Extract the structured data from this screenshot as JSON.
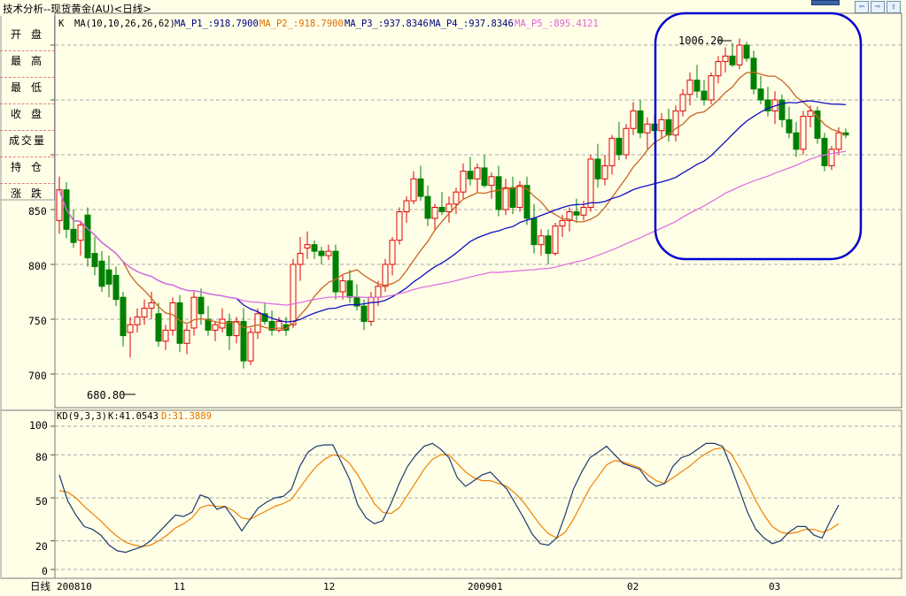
{
  "window": {
    "title": "技术分析--现货黄金(AU)<日线>",
    "controls": [
      "⇦",
      "⇨",
      "⇧"
    ]
  },
  "side_panel": {
    "items": [
      "开盘",
      "最高",
      "最低",
      "收盘",
      "成交量",
      "持仓",
      "涨跌"
    ]
  },
  "price_panel": {
    "k_label": "K",
    "ma_name": "MA(10,10,26,26,62)",
    "ma_values": [
      {
        "label": "MA_P1_:918.7900",
        "color": "#000080"
      },
      {
        "label": "MA_P2_:918.7900",
        "color": "#e07000"
      },
      {
        "label": "MA_P3_:937.8346",
        "color": "#000080"
      },
      {
        "label": "MA_P4_:937.8346",
        "color": "#000080"
      },
      {
        "label": "MA_P5_:895.4121",
        "color": "#e060e0"
      }
    ],
    "high_marker": "1006.20",
    "low_marker": "680.80",
    "y_ticks": [
      "850",
      "800",
      "750",
      "700"
    ]
  },
  "kd_panel": {
    "name": "KD(9,3,3)",
    "k_value": "K:41.0543",
    "d_value": "D:31.3889",
    "y_ticks": [
      "100",
      "80",
      "50",
      "20",
      "0"
    ]
  },
  "x_axis": {
    "period": "日线",
    "labels": [
      "200810",
      "11",
      "12",
      "200901",
      "02",
      "03"
    ]
  },
  "colors": {
    "up": "#e00000",
    "down": "#008000",
    "ma_short": "#c86420",
    "ma_mid": "#1010c0",
    "ma_long": "#e070e0",
    "k_line": "#1e3a70",
    "d_line": "#f08000",
    "highlight": "#0000d0"
  },
  "chart_data": {
    "type": "candlestick",
    "instrument": "现货黄金(AU)",
    "interval": "日线",
    "price_ylim": [
      670,
      1020
    ],
    "kd_ylim": [
      0,
      100
    ],
    "ohlc": [
      [
        840,
        880,
        828,
        868
      ],
      [
        868,
        875,
        824,
        832
      ],
      [
        832,
        850,
        815,
        820
      ],
      [
        822,
        840,
        808,
        836
      ],
      [
        845,
        852,
        798,
        806
      ],
      [
        810,
        825,
        790,
        798
      ],
      [
        803,
        812,
        775,
        780
      ],
      [
        795,
        808,
        770,
        782
      ],
      [
        790,
        798,
        762,
        768
      ],
      [
        770,
        775,
        725,
        735
      ],
      [
        738,
        752,
        715,
        745
      ],
      [
        745,
        760,
        738,
        752
      ],
      [
        752,
        768,
        745,
        760
      ],
      [
        760,
        775,
        750,
        765
      ],
      [
        755,
        765,
        725,
        730
      ],
      [
        730,
        745,
        722,
        740
      ],
      [
        740,
        770,
        735,
        765
      ],
      [
        765,
        772,
        720,
        728
      ],
      [
        728,
        745,
        718,
        740
      ],
      [
        742,
        775,
        735,
        770
      ],
      [
        770,
        778,
        745,
        755
      ],
      [
        750,
        762,
        735,
        740
      ],
      [
        740,
        748,
        730,
        745
      ],
      [
        742,
        760,
        738,
        750
      ],
      [
        748,
        755,
        722,
        735
      ],
      [
        735,
        752,
        728,
        748
      ],
      [
        748,
        760,
        705,
        712
      ],
      [
        712,
        742,
        708,
        738
      ],
      [
        738,
        760,
        732,
        755
      ],
      [
        755,
        765,
        745,
        748
      ],
      [
        748,
        758,
        735,
        740
      ],
      [
        740,
        752,
        738,
        748
      ],
      [
        745,
        752,
        735,
        740
      ],
      [
        745,
        805,
        742,
        800
      ],
      [
        800,
        825,
        785,
        810
      ],
      [
        815,
        830,
        805,
        818
      ],
      [
        818,
        822,
        805,
        812
      ],
      [
        812,
        816,
        800,
        808
      ],
      [
        808,
        818,
        804,
        812
      ],
      [
        812,
        818,
        768,
        775
      ],
      [
        775,
        790,
        768,
        785
      ],
      [
        785,
        795,
        765,
        770
      ],
      [
        770,
        782,
        758,
        762
      ],
      [
        762,
        768,
        740,
        748
      ],
      [
        748,
        775,
        744,
        770
      ],
      [
        770,
        785,
        762,
        780
      ],
      [
        780,
        805,
        775,
        800
      ],
      [
        800,
        825,
        790,
        822
      ],
      [
        822,
        852,
        818,
        848
      ],
      [
        848,
        862,
        838,
        858
      ],
      [
        858,
        885,
        855,
        878
      ],
      [
        878,
        890,
        858,
        862
      ],
      [
        862,
        872,
        835,
        842
      ],
      [
        842,
        855,
        832,
        852
      ],
      [
        852,
        866,
        845,
        848
      ],
      [
        848,
        862,
        838,
        855
      ],
      [
        855,
        870,
        846,
        866
      ],
      [
        866,
        892,
        860,
        885
      ],
      [
        885,
        898,
        872,
        878
      ],
      [
        878,
        892,
        866,
        888
      ],
      [
        888,
        900,
        870,
        872
      ],
      [
        872,
        884,
        860,
        880
      ],
      [
        880,
        890,
        844,
        850
      ],
      [
        850,
        878,
        845,
        870
      ],
      [
        870,
        880,
        846,
        852
      ],
      [
        852,
        876,
        848,
        872
      ],
      [
        872,
        880,
        836,
        842
      ],
      [
        842,
        855,
        810,
        818
      ],
      [
        818,
        832,
        808,
        826
      ],
      [
        826,
        832,
        800,
        810
      ],
      [
        810,
        838,
        808,
        835
      ],
      [
        835,
        845,
        825,
        840
      ],
      [
        840,
        852,
        830,
        848
      ],
      [
        848,
        860,
        838,
        845
      ],
      [
        845,
        858,
        840,
        852
      ],
      [
        852,
        900,
        848,
        896
      ],
      [
        896,
        910,
        870,
        878
      ],
      [
        878,
        900,
        872,
        890
      ],
      [
        890,
        918,
        882,
        915
      ],
      [
        915,
        930,
        895,
        900
      ],
      [
        900,
        928,
        896,
        924
      ],
      [
        924,
        948,
        918,
        940
      ],
      [
        940,
        950,
        915,
        920
      ],
      [
        920,
        934,
        905,
        928
      ],
      [
        928,
        936,
        915,
        922
      ],
      [
        922,
        938,
        915,
        932
      ],
      [
        932,
        942,
        912,
        918
      ],
      [
        918,
        945,
        912,
        940
      ],
      [
        940,
        960,
        935,
        955
      ],
      [
        955,
        975,
        945,
        968
      ],
      [
        968,
        982,
        952,
        958
      ],
      [
        958,
        968,
        945,
        950
      ],
      [
        950,
        975,
        946,
        972
      ],
      [
        972,
        990,
        965,
        985
      ],
      [
        985,
        998,
        975,
        990
      ],
      [
        990,
        1002,
        980,
        982
      ],
      [
        982,
        1006,
        978,
        1000
      ],
      [
        1000,
        1003,
        985,
        988
      ],
      [
        988,
        995,
        955,
        960
      ],
      [
        960,
        972,
        946,
        950
      ],
      [
        950,
        962,
        935,
        940
      ],
      [
        940,
        958,
        928,
        950
      ],
      [
        950,
        955,
        925,
        932
      ],
      [
        932,
        944,
        915,
        920
      ],
      [
        920,
        930,
        898,
        905
      ],
      [
        905,
        940,
        900,
        935
      ],
      [
        935,
        945,
        925,
        940
      ],
      [
        940,
        944,
        910,
        915
      ],
      [
        915,
        920,
        885,
        890
      ],
      [
        890,
        908,
        886,
        905
      ],
      [
        905,
        925,
        900,
        920
      ],
      [
        920,
        924,
        915,
        918
      ]
    ],
    "kd": {
      "k": [
        66,
        48,
        38,
        30,
        28,
        24,
        17,
        13,
        12,
        14,
        16,
        20,
        26,
        32,
        38,
        37,
        40,
        52,
        50,
        42,
        44,
        36,
        27,
        35,
        43,
        47,
        50,
        51,
        56,
        72,
        82,
        86,
        87,
        87,
        75,
        63,
        45,
        36,
        32,
        34,
        46,
        60,
        72,
        80,
        86,
        88,
        84,
        78,
        64,
        58,
        62,
        66,
        68,
        62,
        56,
        46,
        36,
        25,
        18,
        17,
        22,
        38,
        56,
        68,
        78,
        82,
        86,
        80,
        74,
        72,
        70,
        62,
        58,
        60,
        72,
        78,
        80,
        84,
        88,
        88,
        86,
        72,
        56,
        40,
        28,
        22,
        18,
        20,
        26,
        30,
        30,
        24,
        22,
        34,
        45
      ],
      "d": [
        55,
        54,
        50,
        44,
        39,
        34,
        28,
        23,
        19,
        17,
        16,
        17,
        20,
        24,
        29,
        32,
        36,
        43,
        45,
        44,
        44,
        41,
        36,
        35,
        38,
        41,
        44,
        46,
        49,
        57,
        65,
        72,
        77,
        80,
        79,
        74,
        66,
        56,
        46,
        40,
        39,
        43,
        52,
        61,
        70,
        77,
        80,
        80,
        74,
        68,
        64,
        62,
        62,
        60,
        58,
        53,
        47,
        39,
        31,
        25,
        22,
        26,
        35,
        46,
        57,
        65,
        73,
        76,
        75,
        73,
        71,
        66,
        62,
        60,
        64,
        68,
        72,
        77,
        81,
        84,
        85,
        81,
        71,
        60,
        48,
        38,
        30,
        26,
        25,
        26,
        28,
        28,
        26,
        28,
        32
      ]
    }
  }
}
